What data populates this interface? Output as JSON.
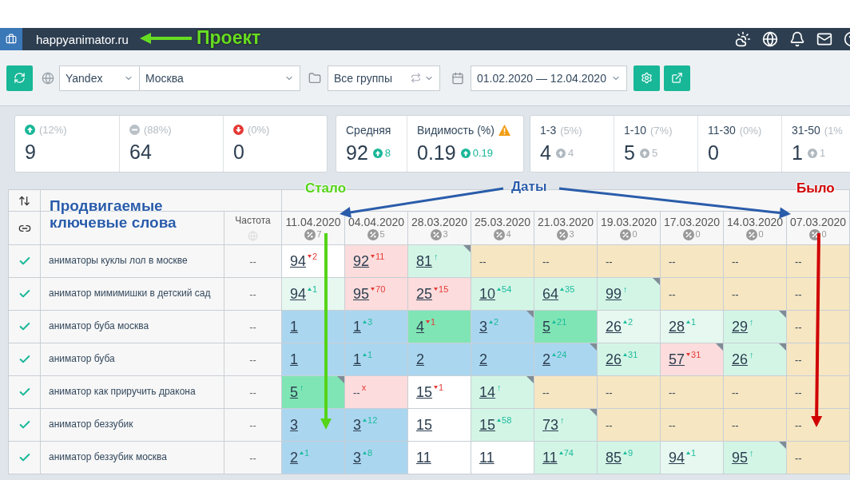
{
  "topbar": {
    "project": "happyanimator.ru"
  },
  "toolbar": {
    "engine": "Yandex",
    "region": "Москва",
    "group": "Все группы",
    "date_range": "01.02.2020 — 12.04.2020"
  },
  "stats": [
    [
      {
        "kind": "up",
        "note": "(12%)",
        "value": "9"
      },
      {
        "kind": "neutral",
        "note": "(88%)",
        "value": "64"
      },
      {
        "kind": "down",
        "note": "(0%)",
        "value": "0"
      }
    ],
    [
      {
        "kind": "average",
        "label": "Средняя",
        "value": "92",
        "delta": "8"
      },
      {
        "kind": "visibility",
        "label": "Видимость (%)",
        "value": "0.19",
        "delta": "0.19"
      }
    ],
    [
      {
        "kind": "range",
        "label": "1-3",
        "note": "(5%)",
        "value": "4",
        "delta": "4"
      },
      {
        "kind": "range",
        "label": "1-10",
        "note": "(7%)",
        "value": "5",
        "delta": "5"
      },
      {
        "kind": "range",
        "label": "11-30",
        "note": "(0%)",
        "value": "0"
      },
      {
        "kind": "range",
        "label": "31-50",
        "note": "(1%",
        "value": "1",
        "delta": "1"
      }
    ]
  ],
  "table": {
    "frequency_heading": "Частота",
    "dates": [
      {
        "date": "11.04.2020",
        "count": "7"
      },
      {
        "date": "04.04.2020",
        "count": "5"
      },
      {
        "date": "28.03.2020",
        "count": "3"
      },
      {
        "date": "25.03.2020",
        "count": "4"
      },
      {
        "date": "21.03.2020",
        "count": "3"
      },
      {
        "date": "19.03.2020",
        "count": "0"
      },
      {
        "date": "17.03.2020",
        "count": "0"
      },
      {
        "date": "14.03.2020",
        "count": "0"
      },
      {
        "date": "07.03.2020",
        "count": "0"
      }
    ],
    "rows": [
      {
        "checked": true,
        "keyword": "аниматоры куклы лол в москве",
        "frequency": "--",
        "cells": [
          {
            "value": "94",
            "linked": true,
            "kind": "down",
            "delta": "2",
            "color": "#ffffff",
            "flag": false
          },
          {
            "value": "92",
            "linked": true,
            "kind": "down",
            "delta": "11",
            "color": "#fcdcdc",
            "flag": false
          },
          {
            "value": "81",
            "linked": true,
            "kind": "new",
            "delta": "↑",
            "color": "#d3f5e6",
            "flag": true
          },
          {
            "value": "--",
            "linked": false,
            "kind": "none",
            "color": "#f6e6c2",
            "flag": false
          },
          {
            "value": "--",
            "linked": false,
            "kind": "none",
            "color": "#f6e6c2",
            "flag": false
          },
          {
            "value": "--",
            "linked": false,
            "kind": "none",
            "color": "#f6e6c2",
            "flag": false
          },
          {
            "value": "--",
            "linked": false,
            "kind": "none",
            "color": "#f6e6c2",
            "flag": false
          },
          {
            "value": "--",
            "linked": false,
            "kind": "none",
            "color": "#f6e6c2",
            "flag": false
          },
          {
            "value": "--",
            "linked": false,
            "kind": "none",
            "color": "#f6e6c2",
            "flag": false
          }
        ]
      },
      {
        "checked": true,
        "keyword": "аниматор мимимишки в детский сад",
        "frequency": "--",
        "cells": [
          {
            "value": "94",
            "linked": true,
            "kind": "up",
            "delta": "1",
            "color": "#e6f8f0",
            "flag": false
          },
          {
            "value": "95",
            "linked": true,
            "kind": "down",
            "delta": "70",
            "color": "#fcdcdc",
            "flag": false
          },
          {
            "value": "25",
            "linked": true,
            "kind": "down",
            "delta": "15",
            "color": "#fcdcdc",
            "flag": false
          },
          {
            "value": "10",
            "linked": true,
            "kind": "up",
            "delta": "54",
            "color": "#d3f5e6",
            "flag": false
          },
          {
            "value": "64",
            "linked": true,
            "kind": "up",
            "delta": "35",
            "color": "#d3f5e6",
            "flag": false
          },
          {
            "value": "99",
            "linked": true,
            "kind": "new",
            "delta": "↑",
            "color": "#d3f5e6",
            "flag": true
          },
          {
            "value": "--",
            "linked": false,
            "kind": "none",
            "color": "#f6e6c2",
            "flag": false
          },
          {
            "value": "--",
            "linked": false,
            "kind": "none",
            "color": "#f6e6c2",
            "flag": false
          },
          {
            "value": "--",
            "linked": false,
            "kind": "none",
            "color": "#f6e6c2",
            "flag": false
          }
        ]
      },
      {
        "checked": true,
        "keyword": "аниматор буба москва",
        "frequency": "--",
        "cells": [
          {
            "value": "1",
            "linked": true,
            "kind": "none",
            "color": "#abd6f0",
            "flag": false
          },
          {
            "value": "1",
            "linked": true,
            "kind": "up",
            "delta": "3",
            "color": "#abd6f0",
            "flag": false
          },
          {
            "value": "4",
            "linked": true,
            "kind": "down",
            "delta": "1",
            "color": "#80e5b5",
            "flag": false
          },
          {
            "value": "3",
            "linked": true,
            "kind": "up",
            "delta": "2",
            "color": "#abd6f0",
            "flag": true
          },
          {
            "value": "5",
            "linked": true,
            "kind": "up",
            "delta": "21",
            "color": "#80e5b5",
            "flag": false
          },
          {
            "value": "26",
            "linked": true,
            "kind": "up",
            "delta": "2",
            "color": "#e6f8f0",
            "flag": false
          },
          {
            "value": "28",
            "linked": true,
            "kind": "up",
            "delta": "1",
            "color": "#e6f8f0",
            "flag": false
          },
          {
            "value": "29",
            "linked": true,
            "kind": "new",
            "delta": "↑",
            "color": "#d3f5e6",
            "flag": true
          },
          {
            "value": "--",
            "linked": false,
            "kind": "none",
            "color": "#f6e6c2",
            "flag": false
          }
        ]
      },
      {
        "checked": true,
        "keyword": "аниматор буба",
        "frequency": "--",
        "cells": [
          {
            "value": "1",
            "linked": true,
            "kind": "none",
            "color": "#abd6f0",
            "flag": false
          },
          {
            "value": "1",
            "linked": true,
            "kind": "up",
            "delta": "1",
            "color": "#abd6f0",
            "flag": false
          },
          {
            "value": "2",
            "linked": true,
            "kind": "none",
            "color": "#abd6f0",
            "flag": false
          },
          {
            "value": "2",
            "linked": true,
            "kind": "none",
            "color": "#abd6f0",
            "flag": false
          },
          {
            "value": "2",
            "linked": true,
            "kind": "up",
            "delta": "24",
            "color": "#abd6f0",
            "flag": true
          },
          {
            "value": "26",
            "linked": true,
            "kind": "up",
            "delta": "31",
            "color": "#d3f5e6",
            "flag": false
          },
          {
            "value": "57",
            "linked": true,
            "kind": "down",
            "delta": "31",
            "color": "#fcdcdc",
            "flag": true
          },
          {
            "value": "26",
            "linked": true,
            "kind": "new",
            "delta": "↑",
            "color": "#d3f5e6",
            "flag": true
          },
          {
            "value": "--",
            "linked": false,
            "kind": "none",
            "color": "#f6e6c2",
            "flag": false
          }
        ]
      },
      {
        "checked": true,
        "keyword": "аниматор как приручить дракона",
        "frequency": "--",
        "cells": [
          {
            "value": "5",
            "linked": true,
            "kind": "new",
            "delta": "↑",
            "color": "#80e5b5",
            "flag": true
          },
          {
            "value": "--",
            "linked": false,
            "kind": "gone",
            "delta": "x",
            "color": "#fcdcdc",
            "flag": false
          },
          {
            "value": "15",
            "linked": true,
            "kind": "down",
            "delta": "1",
            "color": "#ffffff",
            "flag": false
          },
          {
            "value": "14",
            "linked": true,
            "kind": "new",
            "delta": "↑",
            "color": "#d3f5e6",
            "flag": true
          },
          {
            "value": "--",
            "linked": false,
            "kind": "none",
            "color": "#f6e6c2",
            "flag": false
          },
          {
            "value": "--",
            "linked": false,
            "kind": "none",
            "color": "#f6e6c2",
            "flag": false
          },
          {
            "value": "--",
            "linked": false,
            "kind": "none",
            "color": "#f6e6c2",
            "flag": false
          },
          {
            "value": "--",
            "linked": false,
            "kind": "none",
            "color": "#f6e6c2",
            "flag": false
          },
          {
            "value": "--",
            "linked": false,
            "kind": "none",
            "color": "#f6e6c2",
            "flag": false
          }
        ]
      },
      {
        "checked": true,
        "keyword": "аниматор беззубик",
        "frequency": "--",
        "cells": [
          {
            "value": "3",
            "linked": true,
            "kind": "none",
            "color": "#abd6f0",
            "flag": false
          },
          {
            "value": "3",
            "linked": true,
            "kind": "up",
            "delta": "12",
            "color": "#abd6f0",
            "flag": false
          },
          {
            "value": "15",
            "linked": true,
            "kind": "none",
            "color": "#ffffff",
            "flag": false
          },
          {
            "value": "15",
            "linked": true,
            "kind": "up",
            "delta": "58",
            "color": "#d3f5e6",
            "flag": false
          },
          {
            "value": "73",
            "linked": true,
            "kind": "new",
            "delta": "↑",
            "color": "#d3f5e6",
            "flag": true
          },
          {
            "value": "--",
            "linked": false,
            "kind": "none",
            "color": "#f6e6c2",
            "flag": false
          },
          {
            "value": "--",
            "linked": false,
            "kind": "none",
            "color": "#f6e6c2",
            "flag": false
          },
          {
            "value": "--",
            "linked": false,
            "kind": "none",
            "color": "#f6e6c2",
            "flag": false
          },
          {
            "value": "--",
            "linked": false,
            "kind": "none",
            "color": "#f6e6c2",
            "flag": false
          }
        ]
      },
      {
        "checked": true,
        "keyword": "аниматор беззубик москва",
        "frequency": "--",
        "cells": [
          {
            "value": "2",
            "linked": true,
            "kind": "up",
            "delta": "1",
            "color": "#abd6f0",
            "flag": false
          },
          {
            "value": "3",
            "linked": true,
            "kind": "up",
            "delta": "8",
            "color": "#abd6f0",
            "flag": false
          },
          {
            "value": "11",
            "linked": true,
            "kind": "none",
            "color": "#ffffff",
            "flag": false
          },
          {
            "value": "11",
            "linked": true,
            "kind": "none",
            "color": "#ffffff",
            "flag": false
          },
          {
            "value": "11",
            "linked": true,
            "kind": "up",
            "delta": "74",
            "color": "#d3f5e6",
            "flag": false
          },
          {
            "value": "85",
            "linked": true,
            "kind": "up",
            "delta": "9",
            "color": "#d3f5e6",
            "flag": false
          },
          {
            "value": "94",
            "linked": true,
            "kind": "up",
            "delta": "1",
            "color": "#e6f8f0",
            "flag": false
          },
          {
            "value": "95",
            "linked": true,
            "kind": "new",
            "delta": "↑",
            "color": "#d3f5e6",
            "flag": true
          },
          {
            "value": "--",
            "linked": false,
            "kind": "none",
            "color": "#f6e6c2",
            "flag": false
          }
        ]
      }
    ]
  },
  "annotations": [
    {
      "text": "Проект",
      "color": "#66dd22"
    },
    {
      "text": "Продвигаемые ключевые слова",
      "color": "#2a5caa"
    },
    {
      "text": "Стало",
      "color": "#55d418"
    },
    {
      "text": "Даты",
      "color": "#2a5caa"
    },
    {
      "text": "Было",
      "color": "#d00000"
    }
  ]
}
